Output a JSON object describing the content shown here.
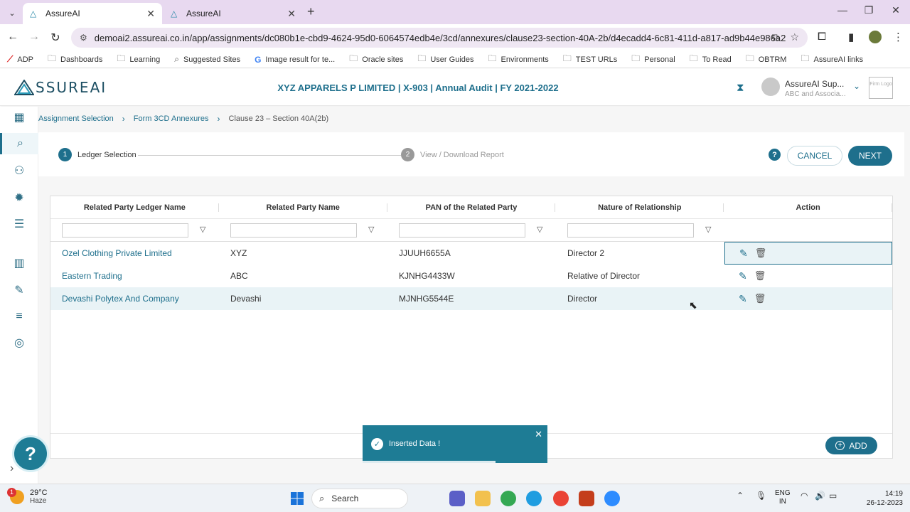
{
  "browser": {
    "tabs": [
      {
        "title": "AssureAI",
        "active": true
      },
      {
        "title": "AssureAI",
        "active": false
      }
    ],
    "url": "demoai2.assureai.co.in/app/assignments/dc080b1e-cbd9-4624-95d0-6064574edb4e/3cd/annexures/clause23-section-40A-2b/d4ecadd4-6c81-411d-a817-ad9b44e986a2",
    "bookmarks": [
      "ADP",
      "Dashboards",
      "Learning",
      "Suggested Sites",
      "Image result for te...",
      "Oracle sites",
      "User Guides",
      "Environments",
      "TEST URLs",
      "Personal",
      "To Read",
      "OBTRM",
      "AssureAI links"
    ]
  },
  "header": {
    "logo_text": "SSUREAI",
    "context": "XYZ APPARELS P LIMITED | X-903 | Annual Audit | FY 2021-2022",
    "user_name": "AssureAI Sup...",
    "user_org": "ABC and Associa...",
    "firm_logo": "Firm Logo"
  },
  "breadcrumb": [
    "Assignment Selection",
    "Form 3CD Annexures",
    "Clause 23 – Section 40A(2b)"
  ],
  "stepper": {
    "steps": [
      {
        "num": "1",
        "label": "Ledger Selection"
      },
      {
        "num": "2",
        "label": "View / Download Report"
      }
    ],
    "cancel_label": "CANCEL",
    "next_label": "NEXT"
  },
  "table": {
    "columns": [
      "Related Party Ledger Name",
      "Related Party Name",
      "PAN of the Related Party",
      "Nature of Relationship",
      "Action"
    ],
    "rows": [
      {
        "ledger": "Ozel Clothing Private Limited",
        "party": "XYZ",
        "pan": "JJUUH6655A",
        "relation": "Director 2"
      },
      {
        "ledger": "Eastern Trading",
        "party": "ABC",
        "pan": "KJNHG4433W",
        "relation": "Relative of Director"
      },
      {
        "ledger": "Devashi Polytex And Company",
        "party": "Devashi",
        "pan": "MJNHG5544E",
        "relation": "Director"
      }
    ],
    "add_label": "ADD"
  },
  "toast": {
    "message": "Inserted Data !",
    "progress": 0.72
  },
  "taskbar": {
    "temp": "29°C",
    "condition": "Haze",
    "weather_badge": "1",
    "search_label": "Search",
    "lang_top": "ENG",
    "lang_bottom": "IN",
    "time": "14:19",
    "date": "26-12-2023"
  },
  "colors": {
    "accent": "#1e6f8c",
    "toast": "#1e7c95",
    "row_alt": "#e9f3f6"
  },
  "icons": [
    "dashboard-icon",
    "search-doc-icon",
    "users-icon",
    "settings-gear-icon",
    "document-icon",
    "building-icon",
    "tools-icon",
    "checklist-icon",
    "check-circle-icon",
    "edit-icon",
    "delete-icon",
    "filter-icon",
    "hourglass-icon"
  ]
}
